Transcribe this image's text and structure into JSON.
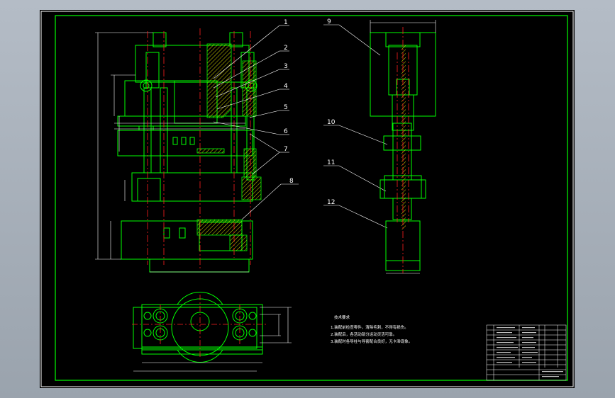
{
  "callouts": {
    "c1": "1",
    "c2": "2",
    "c3": "3",
    "c4": "4",
    "c5": "5",
    "c6": "6",
    "c7": "7",
    "c8": "8",
    "c9": "9",
    "c10": "10",
    "c11": "11",
    "c12": "12"
  },
  "tech_notes": {
    "heading": "技术要求",
    "line1": "1.装配前检查零件，清除毛刺，不得有损伤。",
    "line2": "2.装配后，各活动部分运动灵活可靠。",
    "line3": "3.装配时各导柱与导套配合良好，无卡滞现象。"
  },
  "colors": {
    "sheet": "#000000",
    "border": "#00ff00",
    "centerline": "#ff2020",
    "dimension": "#ffffff",
    "hatch": "#ffff00"
  }
}
